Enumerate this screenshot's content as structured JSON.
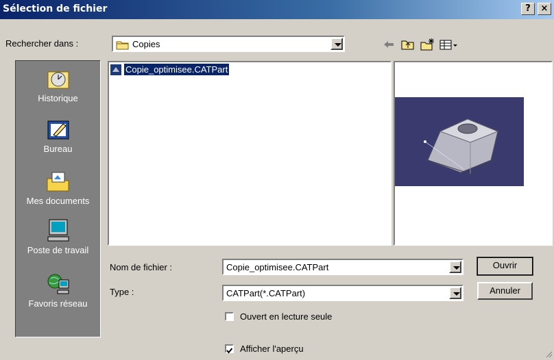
{
  "window": {
    "title": "Sélection de fichier",
    "help_label": "?",
    "close_label": "×"
  },
  "lookin": {
    "label": "Rechercher dans :",
    "value": "Copies"
  },
  "places": [
    {
      "label": "Historique",
      "icon": "history-icon"
    },
    {
      "label": "Bureau",
      "icon": "desktop-icon"
    },
    {
      "label": "Mes documents",
      "icon": "my-documents-icon"
    },
    {
      "label": "Poste de travail",
      "icon": "my-computer-icon"
    },
    {
      "label": "Favoris réseau",
      "icon": "network-places-icon"
    }
  ],
  "files": [
    {
      "name": "Copie_optimisee.CATPart",
      "selected": true,
      "icon": "catpart-icon"
    }
  ],
  "filename": {
    "label": "Nom de fichier :",
    "value": "Copie_optimisee.CATPart"
  },
  "filetype": {
    "label": "Type :",
    "value": "CATPart(*.CATPart)"
  },
  "readonly": {
    "label": "Ouvert en lecture seule",
    "checked": false
  },
  "showpreview": {
    "label": "Afficher l'aperçu",
    "checked": true
  },
  "buttons": {
    "open": "Ouvrir",
    "cancel": "Annuler"
  },
  "colors": {
    "titlebar": "#0a246a",
    "selection": "#0a246a",
    "preview_bg": "#3b3a6e"
  }
}
